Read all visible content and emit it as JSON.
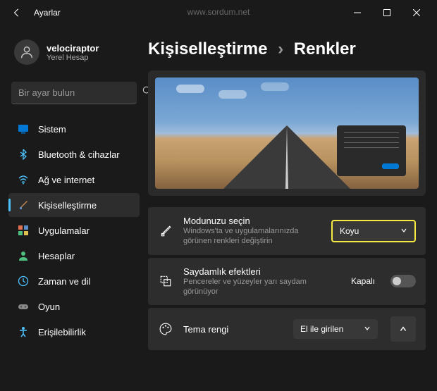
{
  "titlebar": {
    "app_title": "Ayarlar",
    "watermark": "www.sordum.net"
  },
  "user": {
    "name": "velociraptor",
    "type": "Yerel Hesap"
  },
  "search": {
    "placeholder": "Bir ayar bulun"
  },
  "nav": {
    "items": [
      {
        "label": "Sistem"
      },
      {
        "label": "Bluetooth & cihazlar"
      },
      {
        "label": "Ağ ve internet"
      },
      {
        "label": "Kişiselleştirme"
      },
      {
        "label": "Uygulamalar"
      },
      {
        "label": "Hesaplar"
      },
      {
        "label": "Zaman ve dil"
      },
      {
        "label": "Oyun"
      },
      {
        "label": "Erişilebilirlik"
      }
    ]
  },
  "breadcrumb": {
    "parent": "Kişiselleştirme",
    "current": "Renkler"
  },
  "settings": {
    "mode": {
      "title": "Modunuzu seçin",
      "desc": "Windows'ta ve uygulamalarınızda görünen renkleri değiştirin",
      "value": "Koyu"
    },
    "transparency": {
      "title": "Saydamlık efektleri",
      "desc": "Pencereler ve yüzeyler yarı saydam görünüyor",
      "state": "Kapalı"
    },
    "accent": {
      "title": "Tema rengi",
      "value": "El ile girilen"
    }
  }
}
